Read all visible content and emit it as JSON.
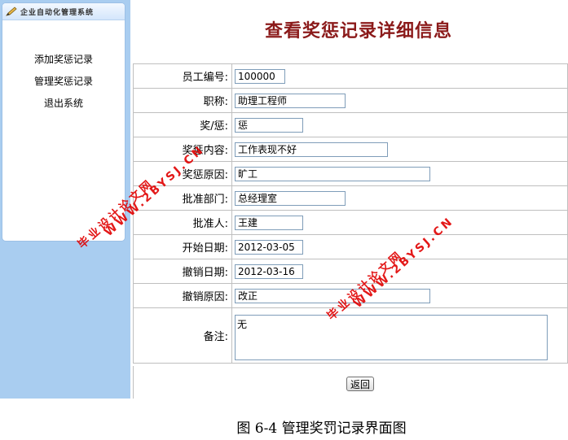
{
  "sidebar": {
    "title": "企业自动化管理系统",
    "items": [
      {
        "label": "添加奖惩记录"
      },
      {
        "label": "管理奖惩记录"
      },
      {
        "label": "退出系统"
      }
    ]
  },
  "page_title": "查看奖惩记录详细信息",
  "form": {
    "employee_id": {
      "label": "员工编号:",
      "value": "100000"
    },
    "position": {
      "label": "职称:",
      "value": "助理工程师"
    },
    "reward_punish": {
      "label": "奖/惩:",
      "value": "惩"
    },
    "content": {
      "label": "奖惩内容:",
      "value": "工作表现不好"
    },
    "reason": {
      "label": "奖惩原因:",
      "value": "旷工"
    },
    "department": {
      "label": "批准部门:",
      "value": "总经理室"
    },
    "approver": {
      "label": "批准人:",
      "value": "王建"
    },
    "start_date": {
      "label": "开始日期:",
      "value": "2012-03-05"
    },
    "revoke_date": {
      "label": "撤销日期:",
      "value": "2012-03-16"
    },
    "revoke_reason": {
      "label": "撤销原因:",
      "value": "改正"
    },
    "remark": {
      "label": "备注:",
      "value": "无"
    }
  },
  "return_button": "返回",
  "caption": "图 6-4  管理奖罚记录界面图",
  "watermarks": {
    "line1": "毕业设计论文网",
    "line2": "WWW.2BYSJ.CN"
  },
  "colors": {
    "sidebar_bg": "#a9cdf0",
    "title_color": "#8b1a1a",
    "watermark": "#e00000"
  }
}
